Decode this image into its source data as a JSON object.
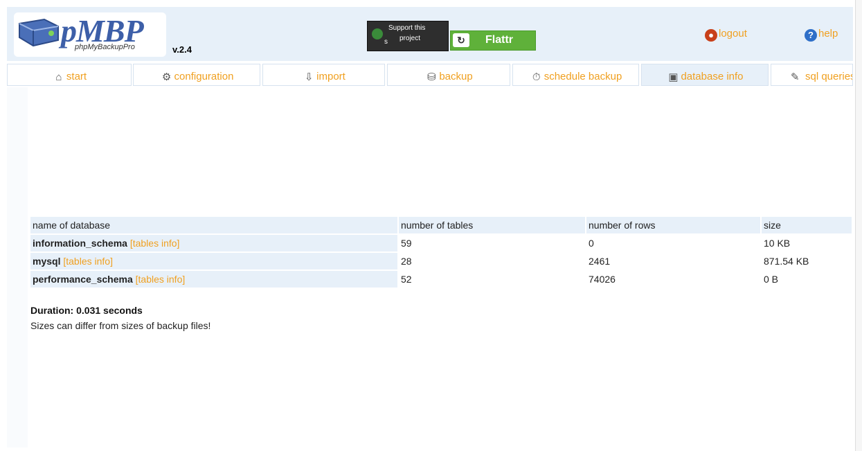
{
  "header": {
    "logo_text": "pMBP",
    "logo_sub": "phpMyBackupPro",
    "version": "v.2.4",
    "support_line1": "Support this",
    "support_line2": "project",
    "support_prefix": "s",
    "flattr_label": "Flattr",
    "logout_label": "logout",
    "help_label": "help",
    "help_icon_glyph": "?"
  },
  "tabs": [
    {
      "label": "start",
      "icon": "home-icon",
      "glyph": "⌂"
    },
    {
      "label": "configuration",
      "icon": "configuration-icon",
      "glyph": "⚙"
    },
    {
      "label": "import",
      "icon": "import-icon",
      "glyph": "⇩"
    },
    {
      "label": "backup",
      "icon": "backup-icon",
      "glyph": "⛁"
    },
    {
      "label": "schedule backup",
      "icon": "stopwatch-icon",
      "glyph": "⏱"
    },
    {
      "label": "database info",
      "icon": "database-icon",
      "glyph": "▣"
    },
    {
      "label": "sql queries",
      "icon": "sql-icon",
      "glyph": "✎"
    }
  ],
  "active_tab": "database info",
  "table": {
    "headers": [
      "name of database",
      "number of tables",
      "number of rows",
      "size"
    ],
    "tables_info_label": "[tables info]",
    "rows": [
      {
        "name": "information_schema",
        "tables": "59",
        "rows": "0",
        "size": "10 KB"
      },
      {
        "name": "mysql",
        "tables": "28",
        "rows": "2461",
        "size": "871.54 KB"
      },
      {
        "name": "performance_schema",
        "tables": "52",
        "rows": "74026",
        "size": "0 B"
      }
    ]
  },
  "duration": "Duration: 0.031 seconds",
  "note": "Sizes can differ from sizes of backup files!",
  "colors": {
    "link": "#f0a020",
    "header_bg": "#e7f0f9",
    "logo_blue": "#3d5fa8",
    "flattr_green": "#5fb13a"
  }
}
